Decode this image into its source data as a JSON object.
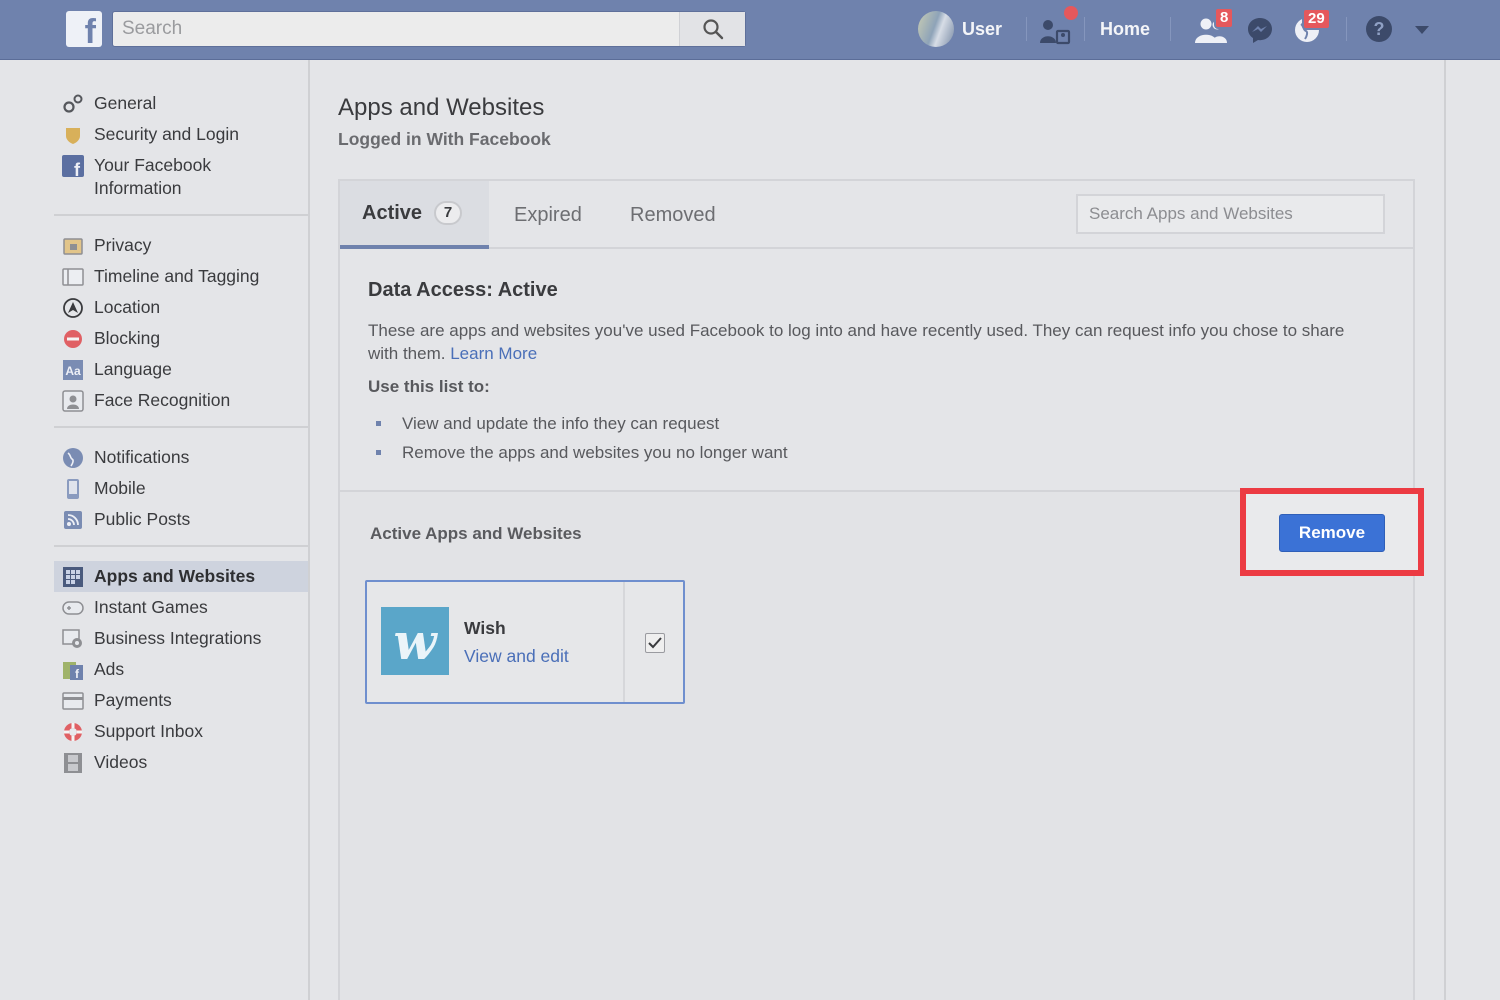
{
  "topbar": {
    "logo_letter": "f",
    "search_placeholder": "Search",
    "user_name": "User",
    "home_label": "Home",
    "friend_requests_badge": "8",
    "notifications_badge": "29"
  },
  "sidebar": {
    "group1": [
      {
        "label": "General",
        "icon": "gears-icon"
      },
      {
        "label": "Security and Login",
        "icon": "shield-icon"
      },
      {
        "label": "Your Facebook Information",
        "icon": "facebook-icon"
      }
    ],
    "group2": [
      {
        "label": "Privacy",
        "icon": "privacy-icon"
      },
      {
        "label": "Timeline and Tagging",
        "icon": "timeline-icon"
      },
      {
        "label": "Location",
        "icon": "location-icon"
      },
      {
        "label": "Blocking",
        "icon": "blocking-icon"
      },
      {
        "label": "Language",
        "icon": "language-icon"
      },
      {
        "label": "Face Recognition",
        "icon": "face-recognition-icon"
      }
    ],
    "group3": [
      {
        "label": "Notifications",
        "icon": "globe-icon"
      },
      {
        "label": "Mobile",
        "icon": "mobile-icon"
      },
      {
        "label": "Public Posts",
        "icon": "rss-icon"
      }
    ],
    "group4": [
      {
        "label": "Apps and Websites",
        "icon": "apps-icon",
        "active": true
      },
      {
        "label": "Instant Games",
        "icon": "gamepad-icon"
      },
      {
        "label": "Business Integrations",
        "icon": "business-icon"
      },
      {
        "label": "Ads",
        "icon": "ads-icon"
      },
      {
        "label": "Payments",
        "icon": "card-icon"
      },
      {
        "label": "Support Inbox",
        "icon": "lifebuoy-icon"
      },
      {
        "label": "Videos",
        "icon": "film-icon"
      }
    ]
  },
  "main": {
    "title": "Apps and Websites",
    "subtitle": "Logged in With Facebook",
    "tabs": [
      {
        "label": "Active",
        "count": "7"
      },
      {
        "label": "Expired"
      },
      {
        "label": "Removed"
      }
    ],
    "search_placeholder": "Search Apps and Websites",
    "info": {
      "heading": "Data Access: Active",
      "description": "These are apps and websites you've used Facebook to log into and have recently used. They can request info you chose to share with them.",
      "learn_more": "Learn More",
      "use_list_label": "Use this list to:",
      "bullets": [
        "View and update the info they can request",
        "Remove the apps and websites you no longer want"
      ]
    },
    "active_apps_label": "Active Apps and Websites",
    "remove_label": "Remove",
    "apps": [
      {
        "name": "Wish",
        "link": "View and edit",
        "checked": true
      }
    ]
  },
  "colors": {
    "topbar": "#6f82ad",
    "accent_button": "#3b72d6",
    "highlight_box": "#ec3b43",
    "link": "#4a6fb8"
  }
}
